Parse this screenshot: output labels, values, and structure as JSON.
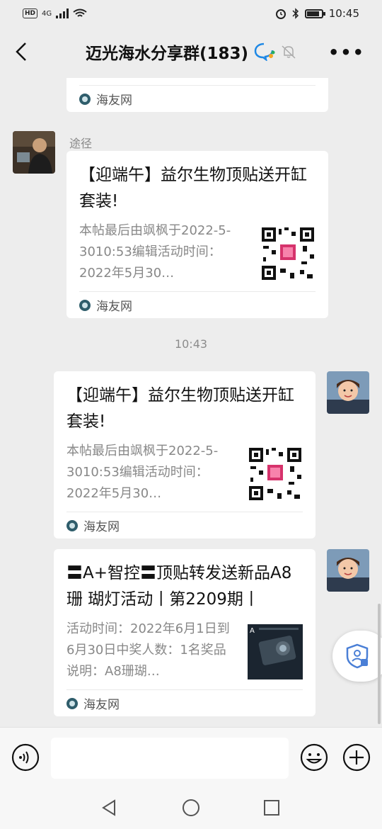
{
  "status_bar": {
    "hd": "HD",
    "network": "4G",
    "time": "10:45"
  },
  "header": {
    "title": "迈光海水分享群(183)"
  },
  "source_name": "海友网",
  "top_card": {
    "source": "海友网"
  },
  "messages": [
    {
      "sender": "途径",
      "title": "【迎端午】益尔生物顶贴送开缸套装!",
      "desc": "本帖最后由飒枫于2022-5-3010:53编辑活动时间：2022年5月30…",
      "source": "海友网"
    },
    {
      "title": "【迎端午】益尔生物顶贴送开缸套装!",
      "desc": "本帖最后由飒枫于2022-5-3010:53编辑活动时间：2022年5月30…",
      "source": "海友网"
    },
    {
      "title": "〓A+智控〓顶贴转发送新品A8珊 瑚灯活动丨第2209期丨",
      "desc": "活动时间：2022年6月1日到6月30日中奖人数：1名奖品说明：A8珊瑚…",
      "source": "海友网"
    }
  ],
  "timestamp": "10:43",
  "colors": {
    "background": "#ededed",
    "card": "#ffffff",
    "secondary_text": "#888888"
  }
}
